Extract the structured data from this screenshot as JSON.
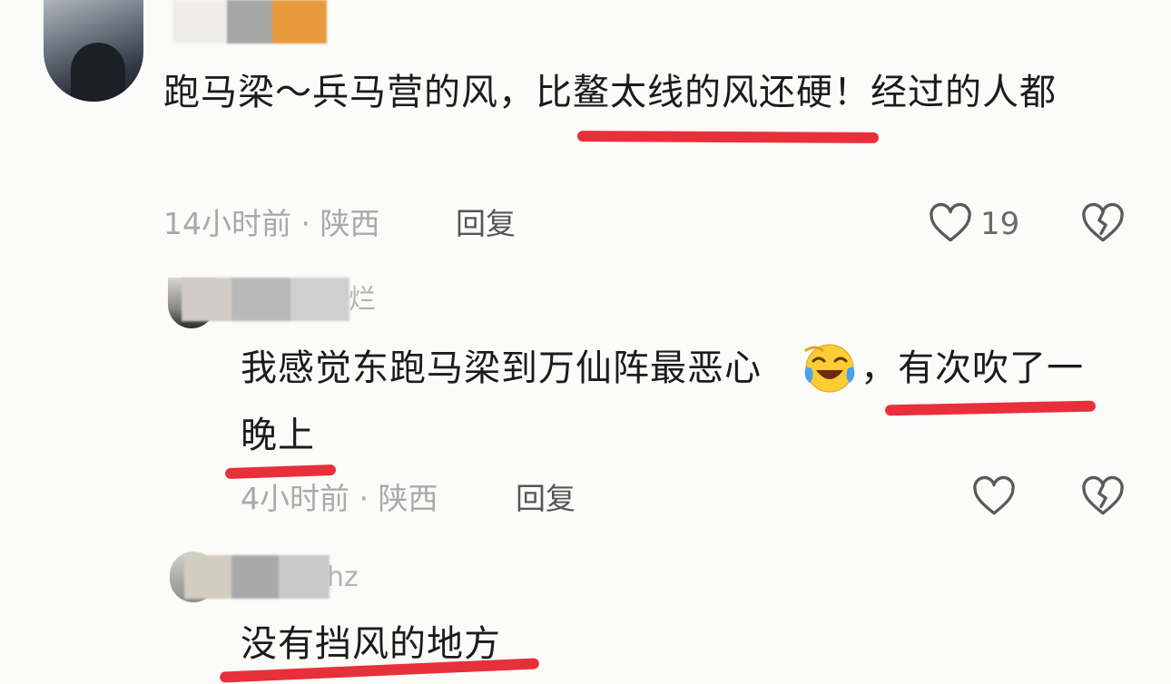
{
  "comments": [
    {
      "text": "跑马梁～兵马营的风，比鳌太线的风还硬！经过的人都",
      "time": "14小时前",
      "location": "陕西",
      "reply_label": "回复",
      "likes": "19",
      "highlight": "比鳌太线的风还硬"
    },
    {
      "name_suffix": "烂",
      "text_line1": "我感觉东跑马梁到万仙阵最恶心",
      "text_comma": "，有次吹了一",
      "text_line2": "晚上",
      "emoji": "laughing-crying-emoji",
      "time": "4小时前",
      "location": "陕西",
      "reply_label": "回复"
    },
    {
      "name_suffix": "hz",
      "text": "没有挡风的地方"
    }
  ],
  "separator": "·",
  "colors": {
    "underline": "#e8303a",
    "meta": "#a9a9a9",
    "text": "#1b1b1b"
  }
}
